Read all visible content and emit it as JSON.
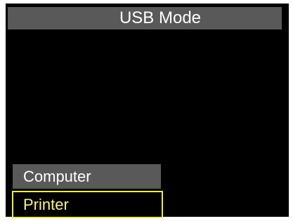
{
  "screen": {
    "title": "USB Mode"
  },
  "menu": {
    "items": [
      {
        "label": "Computer",
        "selected": false
      },
      {
        "label": "Printer",
        "selected": true
      }
    ]
  },
  "colors": {
    "background": "#000000",
    "bar": "#595959",
    "highlight_border": "#f0ec4a",
    "highlight_text": "#f5f28a",
    "text": "#ffffff"
  }
}
